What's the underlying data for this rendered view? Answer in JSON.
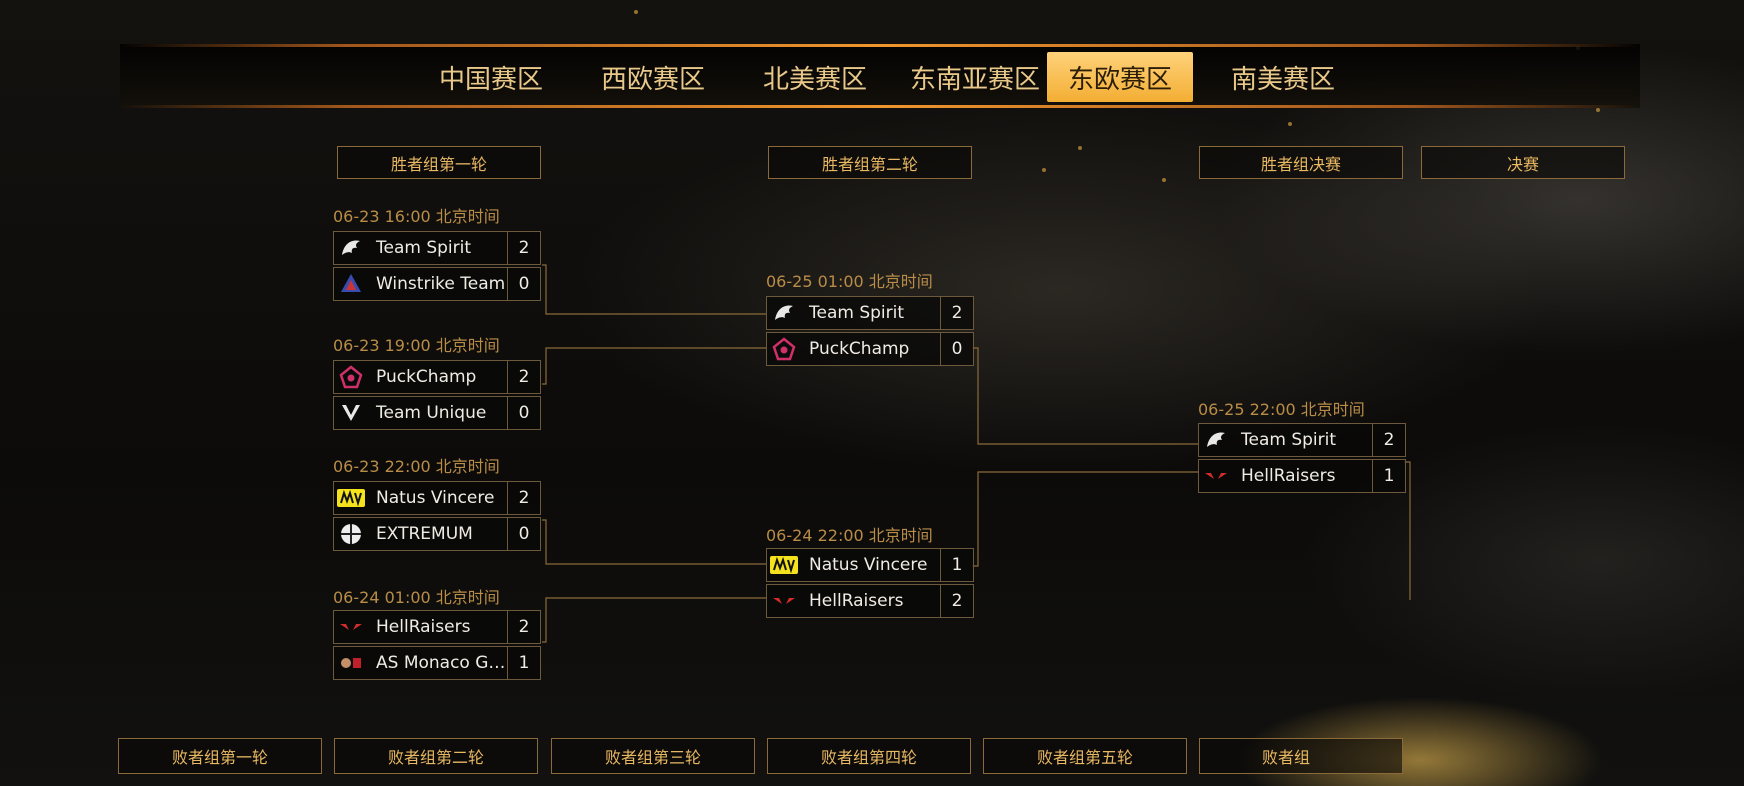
{
  "nav": {
    "tabs": [
      "中国赛区",
      "西欧赛区",
      "北美赛区",
      "东南亚赛区",
      "东欧赛区",
      "南美赛区"
    ],
    "active_index": 4,
    "active_color": "#f3ae33"
  },
  "upper_rounds": [
    "胜者组第一轮",
    "胜者组第二轮",
    "胜者组决赛",
    "决赛"
  ],
  "lower_rounds": [
    "败者组第一轮",
    "败者组第二轮",
    "败者组第三轮",
    "败者组第四轮",
    "败者组第五轮",
    "败者组"
  ],
  "matches": {
    "r1m1": {
      "time": "06-23 16:00 北京时间",
      "a": {
        "name": "Team Spirit",
        "score": "2",
        "logo": "spirit-logo-icon"
      },
      "b": {
        "name": "Winstrike Team",
        "score": "0",
        "logo": "winstrike-logo-icon"
      }
    },
    "r1m2": {
      "time": "06-23 19:00 北京时间",
      "a": {
        "name": "PuckChamp",
        "score": "2",
        "logo": "puckchamp-logo-icon"
      },
      "b": {
        "name": "Team Unique",
        "score": "0",
        "logo": "unique-logo-icon"
      }
    },
    "r1m3": {
      "time": "06-23 22:00 北京时间",
      "a": {
        "name": "Natus Vincere",
        "score": "2",
        "logo": "navi-logo-icon"
      },
      "b": {
        "name": "EXTREMUM",
        "score": "0",
        "logo": "extremum-logo-icon"
      }
    },
    "r1m4": {
      "time": "06-24 01:00 北京时间",
      "a": {
        "name": "HellRaisers",
        "score": "2",
        "logo": "hellraisers-logo-icon"
      },
      "b": {
        "name": "AS Monaco G…",
        "score": "1",
        "logo": "monaco-logo-icon"
      }
    },
    "r2m1": {
      "time": "06-25 01:00 北京时间",
      "a": {
        "name": "Team Spirit",
        "score": "2",
        "logo": "spirit-logo-icon"
      },
      "b": {
        "name": "PuckChamp",
        "score": "0",
        "logo": "puckchamp-logo-icon"
      }
    },
    "r2m2": {
      "time": "06-24 22:00 北京时间",
      "a": {
        "name": "Natus Vincere",
        "score": "1",
        "logo": "navi-logo-icon"
      },
      "b": {
        "name": "HellRaisers",
        "score": "2",
        "logo": "hellraisers-logo-icon"
      }
    },
    "r3m1": {
      "time": "06-25 22:00 北京时间",
      "a": {
        "name": "Team Spirit",
        "score": "2",
        "logo": "spirit-logo-icon"
      },
      "b": {
        "name": "HellRaisers",
        "score": "1",
        "logo": "hellraisers-logo-icon"
      }
    }
  },
  "colors": {
    "accent": "#f3ae33",
    "time": "#b98d47",
    "header_text": "#e9b862",
    "line": "#8a6a3a"
  }
}
